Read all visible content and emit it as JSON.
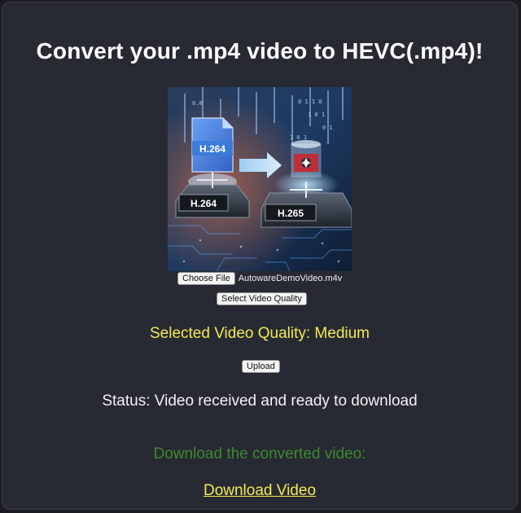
{
  "page": {
    "title": "Convert your .mp4 video to HEVC(.mp4)!"
  },
  "hero_image": {
    "left_chip_label": "H.264",
    "document_label": "H.264",
    "right_chip_label": "H.265"
  },
  "file_input": {
    "button_label": "Choose File",
    "selected_file": "AutowareDemoVideo.m4v"
  },
  "quality": {
    "button_label": "Select Video Quality",
    "selected_text": "Selected Video Quality: Medium"
  },
  "upload": {
    "button_label": "Upload"
  },
  "status": {
    "text": "Status: Video received and ready to download"
  },
  "download": {
    "heading": "Download the converted video:",
    "link_label": "Download Video"
  },
  "colors": {
    "background": "#272a33",
    "title": "#ffffff",
    "accent_yellow": "#f2ea53",
    "download_heading_green": "#3f8a2f"
  }
}
